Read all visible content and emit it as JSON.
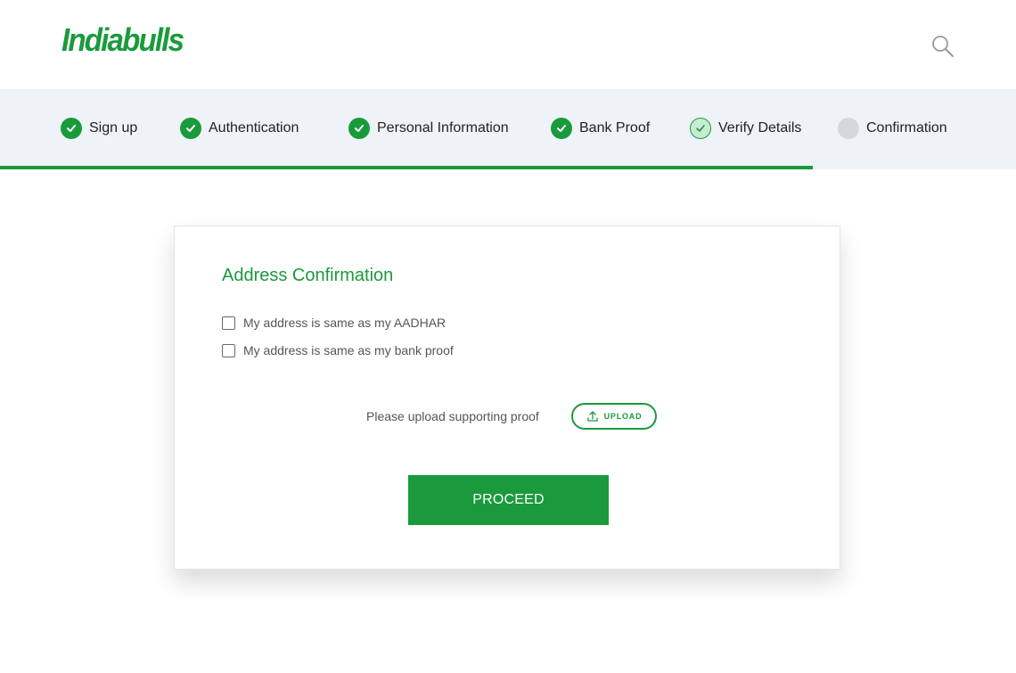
{
  "brand": {
    "logo_text": "Indiabulls",
    "accent_color": "#1a9a3c"
  },
  "header": {
    "search_icon": "search-icon"
  },
  "steps": [
    {
      "label": "Sign up",
      "status": "done"
    },
    {
      "label": "Authentication",
      "status": "done"
    },
    {
      "label": "Personal Information",
      "status": "done"
    },
    {
      "label": "Bank Proof",
      "status": "done"
    },
    {
      "label": "Verify Details",
      "status": "current"
    },
    {
      "label": "Confirmation",
      "status": "pending"
    }
  ],
  "progress": {
    "fraction": 0.8
  },
  "card": {
    "title": "Address Confirmation",
    "options": [
      {
        "label": "My address is same as my AADHAR",
        "checked": false
      },
      {
        "label": "My address is same as my bank proof",
        "checked": false
      }
    ],
    "upload_prompt": "Please upload supporting proof",
    "upload_button": "UPLOAD",
    "upload_icon": "upload-icon",
    "proceed_button": "PROCEED"
  }
}
